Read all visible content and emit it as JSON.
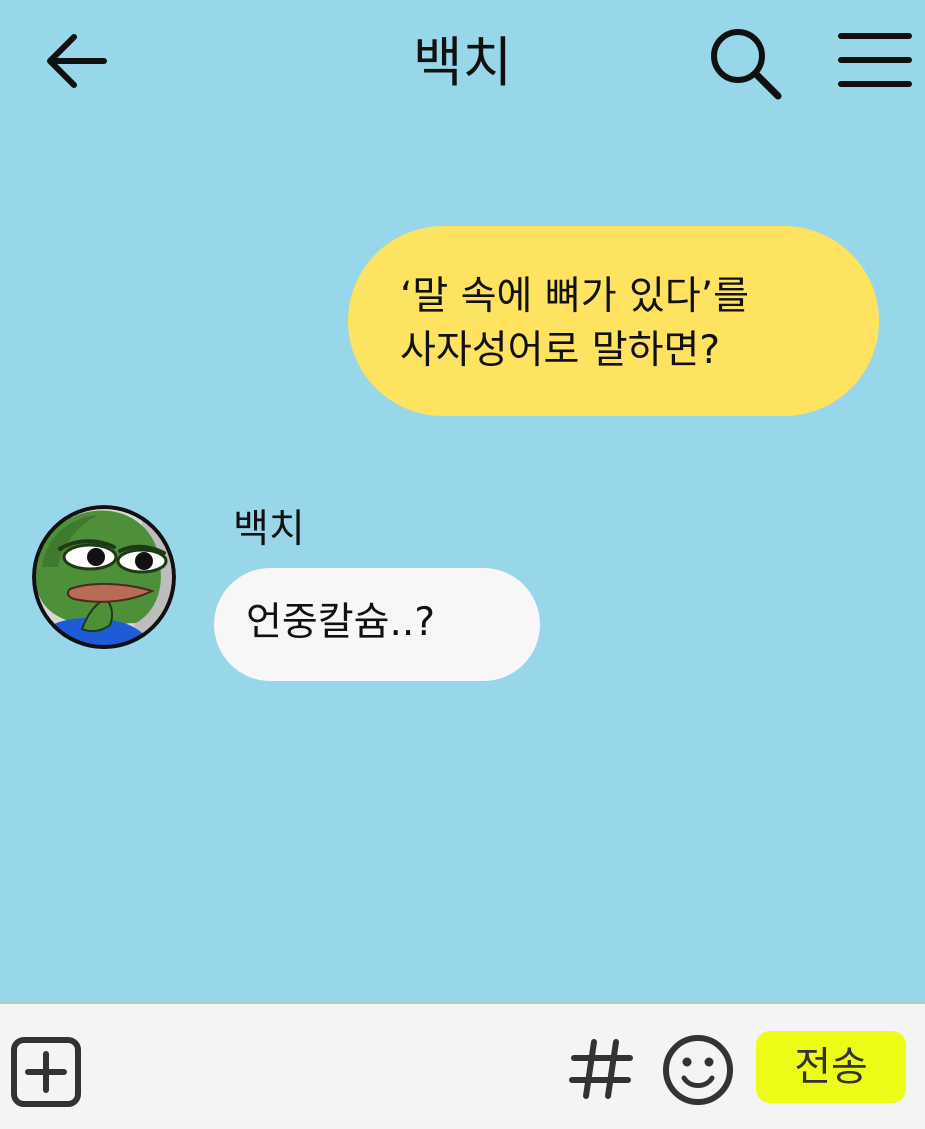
{
  "colors": {
    "background": "#98d6ea",
    "my_bubble": "#fee360",
    "other_bubble": "#f7f7f7",
    "composer": "#f4f4f4",
    "send_button": "#ecfc17",
    "send_text": "#333333",
    "icon": "#111111"
  },
  "header": {
    "title": "백치",
    "back_icon": "arrow-left",
    "search_icon": "magnifier",
    "menu_icon": "hamburger"
  },
  "messages": [
    {
      "sender": "me",
      "text": "‘말 속에 뼈가 있다’를\n사자성어로 말하면?"
    },
    {
      "sender": "other",
      "name": "백치",
      "avatar": "frog-avatar",
      "text": "언중칼슘..?"
    }
  ],
  "composer": {
    "plus_icon": "plus-square",
    "hash_icon": "hash",
    "emoji_icon": "smiley",
    "send_label": "전송"
  }
}
